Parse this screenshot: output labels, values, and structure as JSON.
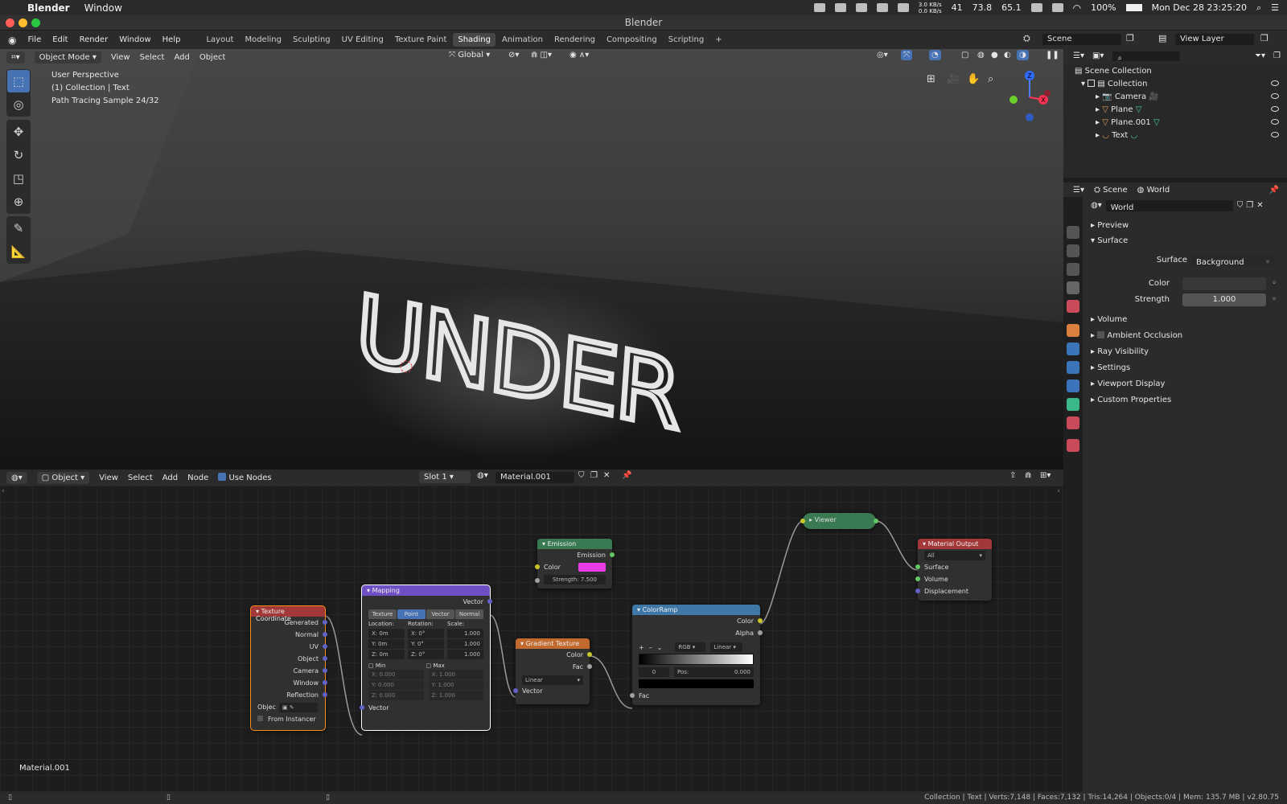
{
  "menubar": {
    "app": "Blender",
    "window": "Window",
    "net_up": "3.0 KB/s",
    "net_down": "0.0 KB/s",
    "mem": "41",
    "cpu": "73.8",
    "temp": "65.1",
    "battery": "100%",
    "clock": "Mon Dec 28  23:25:20"
  },
  "titlebar": {
    "title": "Blender"
  },
  "topbar": {
    "menus": [
      "File",
      "Edit",
      "Render",
      "Window",
      "Help"
    ],
    "workspaces": [
      "Layout",
      "Modeling",
      "Sculpting",
      "UV Editing",
      "Texture Paint",
      "Shading",
      "Animation",
      "Rendering",
      "Compositing",
      "Scripting"
    ],
    "active_workspace": "Shading",
    "add": "+",
    "scene": "Scene",
    "view_layer": "View Layer"
  },
  "viewport": {
    "mode": "Object Mode",
    "menus": [
      "View",
      "Select",
      "Add",
      "Object"
    ],
    "orientation": "Global",
    "overlay_line1": "User Perspective",
    "overlay_line2": "(1) Collection | Text",
    "overlay_line3": "Path Tracing Sample 24/32",
    "scene_text": "UNDER",
    "gizmo_z": "Z",
    "gizmo_x": "X"
  },
  "node_editor": {
    "mode": "Object",
    "menus": [
      "View",
      "Select",
      "Add",
      "Node"
    ],
    "use_nodes": "Use Nodes",
    "slot": "Slot 1",
    "material": "Material.001",
    "label": "Material.001",
    "nodes": {
      "texcoord": {
        "title": "Texture Coordinate",
        "outputs": [
          "Generated",
          "Normal",
          "UV",
          "Object",
          "Camera",
          "Window",
          "Reflection"
        ],
        "object_label": "Objec",
        "from_instancer": "From Instancer"
      },
      "mapping": {
        "title": "Mapping",
        "output": "Vector",
        "tabs": [
          "Texture",
          "Point",
          "Vector",
          "Normal"
        ],
        "active_tab": "Point",
        "location": "Location:",
        "rotation": "Rotation:",
        "scale": "Scale:",
        "loc": [
          "0m",
          "0m",
          "0m"
        ],
        "rot": [
          "0°",
          "0°",
          "0°"
        ],
        "scl": [
          "1.000",
          "1.000",
          "1.000"
        ],
        "axes": [
          "X:",
          "Y:",
          "Z:"
        ],
        "min": "Min",
        "max": "Max",
        "minv": [
          "0.000",
          "0.000",
          "0.000"
        ],
        "maxv": [
          "1.000",
          "1.000",
          "1.000"
        ],
        "input": "Vector"
      },
      "emission": {
        "title": "Emission",
        "output": "Emission",
        "color_label": "Color",
        "color": "#e93ce9",
        "strength_label": "Strength:",
        "strength": "7.500"
      },
      "gradient": {
        "title": "Gradient Texture",
        "outputs": [
          "Color",
          "Fac"
        ],
        "type": "Linear",
        "input": "Vector"
      },
      "colorramp": {
        "title": "ColorRamp",
        "outputs": [
          "Color",
          "Alpha"
        ],
        "color_mode": "RGB",
        "interp": "Linear",
        "index": "0",
        "pos_label": "Pos:",
        "pos": "0.000",
        "input": "Fac",
        "plus": "+",
        "minus": "–"
      },
      "viewer": {
        "title": "Viewer"
      },
      "output": {
        "title": "Material Output",
        "target": "All",
        "inputs": [
          "Surface",
          "Volume",
          "Displacement"
        ]
      }
    }
  },
  "outliner": {
    "root": "Scene Collection",
    "collection": "Collection",
    "items": [
      "Camera",
      "Plane",
      "Plane.001",
      "Text"
    ]
  },
  "properties": {
    "scene_tab": "Scene",
    "world_tab": "World",
    "world_name": "World",
    "panels": {
      "preview": "Preview",
      "surface": "Surface"
    },
    "surface_label": "Surface",
    "surface_value": "Background",
    "color_label": "Color",
    "strength_label": "Strength",
    "strength_value": "1.000",
    "other_panels": [
      "Volume",
      "Ambient Occlusion",
      "Ray Visibility",
      "Settings",
      "Viewport Display",
      "Custom Properties"
    ]
  },
  "statusbar": {
    "text": "Collection | Text | Verts:7,148 | Faces:7,132 | Tris:14,264 | Objects:0/4 | Mem: 135.7 MB | v2.80.75"
  }
}
